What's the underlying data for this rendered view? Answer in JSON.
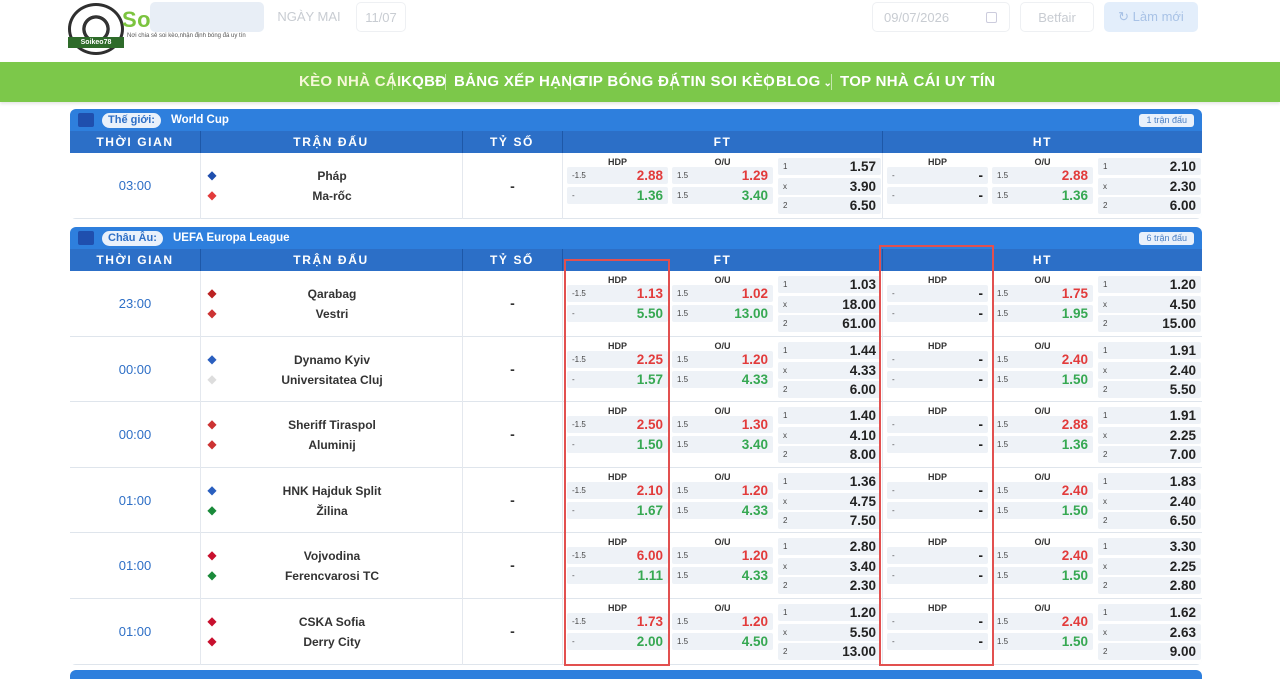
{
  "site": {
    "name": "Soikeo78",
    "badge": "Soikeo78",
    "tagline": "Nơi chia sẻ soi kèo,nhận định bóng đá uy tín"
  },
  "topbar": {
    "tab_today": "",
    "tab_tomorrow": "NGÀY MAI",
    "tab_date": "11/07",
    "date_value": "09/07/2026",
    "betfair_label": "Betfair",
    "refresh_label": "Làm mới"
  },
  "nav": {
    "items": [
      "KÈO NHÀ CÁI",
      "KQBĐ",
      "BẢNG XẾP HẠNG",
      "TIP BÓNG ĐÁ",
      "TIN SOI KÈO",
      "BLOG",
      "TOP NHÀ CÁI UY TÍN"
    ]
  },
  "columns": {
    "time": "THỜI GIAN",
    "match": "TRẬN ĐẤU",
    "score": "TỶ SỐ",
    "ft": "FT",
    "ht": "HT",
    "hdp": "HDP",
    "ou": "O/U"
  },
  "leagues": [
    {
      "region": "Thế giới:",
      "name": "World Cup",
      "count": "1 trận đấu",
      "matches": [
        {
          "time": "03:00",
          "home": "Pháp",
          "away": "Ma-rốc",
          "score": "-",
          "ft": {
            "hdp": [
              {
                "h": "-1.5",
                "v": "2.88"
              },
              {
                "h": "-",
                "v": "1.36"
              }
            ],
            "ou": [
              {
                "h": "1.5",
                "v": "1.29"
              },
              {
                "h": "1.5",
                "v": "3.40"
              }
            ],
            "x12": [
              {
                "h": "1",
                "v": "1.57"
              },
              {
                "h": "x",
                "v": "3.90"
              },
              {
                "h": "2",
                "v": "6.50"
              }
            ]
          },
          "ht": {
            "hdp": [
              {
                "h": "-",
                "v": "-"
              },
              {
                "h": "-",
                "v": "-"
              }
            ],
            "ou": [
              {
                "h": "1.5",
                "v": "2.88"
              },
              {
                "h": "1.5",
                "v": "1.36"
              }
            ],
            "x12": [
              {
                "h": "1",
                "v": "2.10"
              },
              {
                "h": "x",
                "v": "2.30"
              },
              {
                "h": "2",
                "v": "6.00"
              }
            ]
          }
        }
      ]
    },
    {
      "region": "Châu Âu:",
      "name": "UEFA Europa League",
      "count": "6 trận đấu",
      "matches": [
        {
          "time": "23:00",
          "home": "Qarabag",
          "away": "Vestri",
          "score": "-",
          "ft": {
            "hdp": [
              {
                "h": "-1.5",
                "v": "1.13"
              },
              {
                "h": "-",
                "v": "5.50"
              }
            ],
            "ou": [
              {
                "h": "1.5",
                "v": "1.02"
              },
              {
                "h": "1.5",
                "v": "13.00"
              }
            ],
            "x12": [
              {
                "h": "1",
                "v": "1.03"
              },
              {
                "h": "x",
                "v": "18.00"
              },
              {
                "h": "2",
                "v": "61.00"
              }
            ]
          },
          "ht": {
            "hdp": [
              {
                "h": "-",
                "v": "-"
              },
              {
                "h": "-",
                "v": "-"
              }
            ],
            "ou": [
              {
                "h": "1.5",
                "v": "1.75"
              },
              {
                "h": "1.5",
                "v": "1.95"
              }
            ],
            "x12": [
              {
                "h": "1",
                "v": "1.20"
              },
              {
                "h": "x",
                "v": "4.50"
              },
              {
                "h": "2",
                "v": "15.00"
              }
            ]
          }
        },
        {
          "time": "00:00",
          "home": "Dynamo Kyiv",
          "away": "Universitatea Cluj",
          "score": "-",
          "ft": {
            "hdp": [
              {
                "h": "-1.5",
                "v": "2.25"
              },
              {
                "h": "-",
                "v": "1.57"
              }
            ],
            "ou": [
              {
                "h": "1.5",
                "v": "1.20"
              },
              {
                "h": "1.5",
                "v": "4.33"
              }
            ],
            "x12": [
              {
                "h": "1",
                "v": "1.44"
              },
              {
                "h": "x",
                "v": "4.33"
              },
              {
                "h": "2",
                "v": "6.00"
              }
            ]
          },
          "ht": {
            "hdp": [
              {
                "h": "-",
                "v": "-"
              },
              {
                "h": "-",
                "v": "-"
              }
            ],
            "ou": [
              {
                "h": "1.5",
                "v": "2.40"
              },
              {
                "h": "1.5",
                "v": "1.50"
              }
            ],
            "x12": [
              {
                "h": "1",
                "v": "1.91"
              },
              {
                "h": "x",
                "v": "2.40"
              },
              {
                "h": "2",
                "v": "5.50"
              }
            ]
          }
        },
        {
          "time": "00:00",
          "home": "Sheriff Tiraspol",
          "away": "Aluminij",
          "score": "-",
          "ft": {
            "hdp": [
              {
                "h": "-1.5",
                "v": "2.50"
              },
              {
                "h": "-",
                "v": "1.50"
              }
            ],
            "ou": [
              {
                "h": "1.5",
                "v": "1.30"
              },
              {
                "h": "1.5",
                "v": "3.40"
              }
            ],
            "x12": [
              {
                "h": "1",
                "v": "1.40"
              },
              {
                "h": "x",
                "v": "4.10"
              },
              {
                "h": "2",
                "v": "8.00"
              }
            ]
          },
          "ht": {
            "hdp": [
              {
                "h": "-",
                "v": "-"
              },
              {
                "h": "-",
                "v": "-"
              }
            ],
            "ou": [
              {
                "h": "1.5",
                "v": "2.88"
              },
              {
                "h": "1.5",
                "v": "1.36"
              }
            ],
            "x12": [
              {
                "h": "1",
                "v": "1.91"
              },
              {
                "h": "x",
                "v": "2.25"
              },
              {
                "h": "2",
                "v": "7.00"
              }
            ]
          }
        },
        {
          "time": "01:00",
          "home": "HNK Hajduk Split",
          "away": "Žilina",
          "score": "-",
          "ft": {
            "hdp": [
              {
                "h": "-1.5",
                "v": "2.10"
              },
              {
                "h": "-",
                "v": "1.67"
              }
            ],
            "ou": [
              {
                "h": "1.5",
                "v": "1.20"
              },
              {
                "h": "1.5",
                "v": "4.33"
              }
            ],
            "x12": [
              {
                "h": "1",
                "v": "1.36"
              },
              {
                "h": "x",
                "v": "4.75"
              },
              {
                "h": "2",
                "v": "7.50"
              }
            ]
          },
          "ht": {
            "hdp": [
              {
                "h": "-",
                "v": "-"
              },
              {
                "h": "-",
                "v": "-"
              }
            ],
            "ou": [
              {
                "h": "1.5",
                "v": "2.40"
              },
              {
                "h": "1.5",
                "v": "1.50"
              }
            ],
            "x12": [
              {
                "h": "1",
                "v": "1.83"
              },
              {
                "h": "x",
                "v": "2.40"
              },
              {
                "h": "2",
                "v": "6.50"
              }
            ]
          }
        },
        {
          "time": "01:00",
          "home": "Vojvodina",
          "away": "Ferencvarosi TC",
          "score": "-",
          "ft": {
            "hdp": [
              {
                "h": "-1.5",
                "v": "6.00"
              },
              {
                "h": "-",
                "v": "1.11"
              }
            ],
            "ou": [
              {
                "h": "1.5",
                "v": "1.20"
              },
              {
                "h": "1.5",
                "v": "4.33"
              }
            ],
            "x12": [
              {
                "h": "1",
                "v": "2.80"
              },
              {
                "h": "x",
                "v": "3.40"
              },
              {
                "h": "2",
                "v": "2.30"
              }
            ]
          },
          "ht": {
            "hdp": [
              {
                "h": "-",
                "v": "-"
              },
              {
                "h": "-",
                "v": "-"
              }
            ],
            "ou": [
              {
                "h": "1.5",
                "v": "2.40"
              },
              {
                "h": "1.5",
                "v": "1.50"
              }
            ],
            "x12": [
              {
                "h": "1",
                "v": "3.30"
              },
              {
                "h": "x",
                "v": "2.25"
              },
              {
                "h": "2",
                "v": "2.80"
              }
            ]
          }
        },
        {
          "time": "01:00",
          "home": "CSKA Sofia",
          "away": "Derry City",
          "score": "-",
          "ft": {
            "hdp": [
              {
                "h": "-1.5",
                "v": "1.73"
              },
              {
                "h": "-",
                "v": "2.00"
              }
            ],
            "ou": [
              {
                "h": "1.5",
                "v": "1.20"
              },
              {
                "h": "1.5",
                "v": "4.50"
              }
            ],
            "x12": [
              {
                "h": "1",
                "v": "1.20"
              },
              {
                "h": "x",
                "v": "5.50"
              },
              {
                "h": "2",
                "v": "13.00"
              }
            ]
          },
          "ht": {
            "hdp": [
              {
                "h": "-",
                "v": "-"
              },
              {
                "h": "-",
                "v": "-"
              }
            ],
            "ou": [
              {
                "h": "1.5",
                "v": "2.40"
              },
              {
                "h": "1.5",
                "v": "1.50"
              }
            ],
            "x12": [
              {
                "h": "1",
                "v": "1.62"
              },
              {
                "h": "x",
                "v": "2.63"
              },
              {
                "h": "2",
                "v": "9.00"
              }
            ]
          }
        }
      ]
    }
  ],
  "colors": {
    "brand_green": "#7cc84a",
    "league_blue": "#2e7fdd",
    "odds_red": "#e23b3b",
    "odds_green": "#36a852",
    "highlight": "#e2504f"
  }
}
